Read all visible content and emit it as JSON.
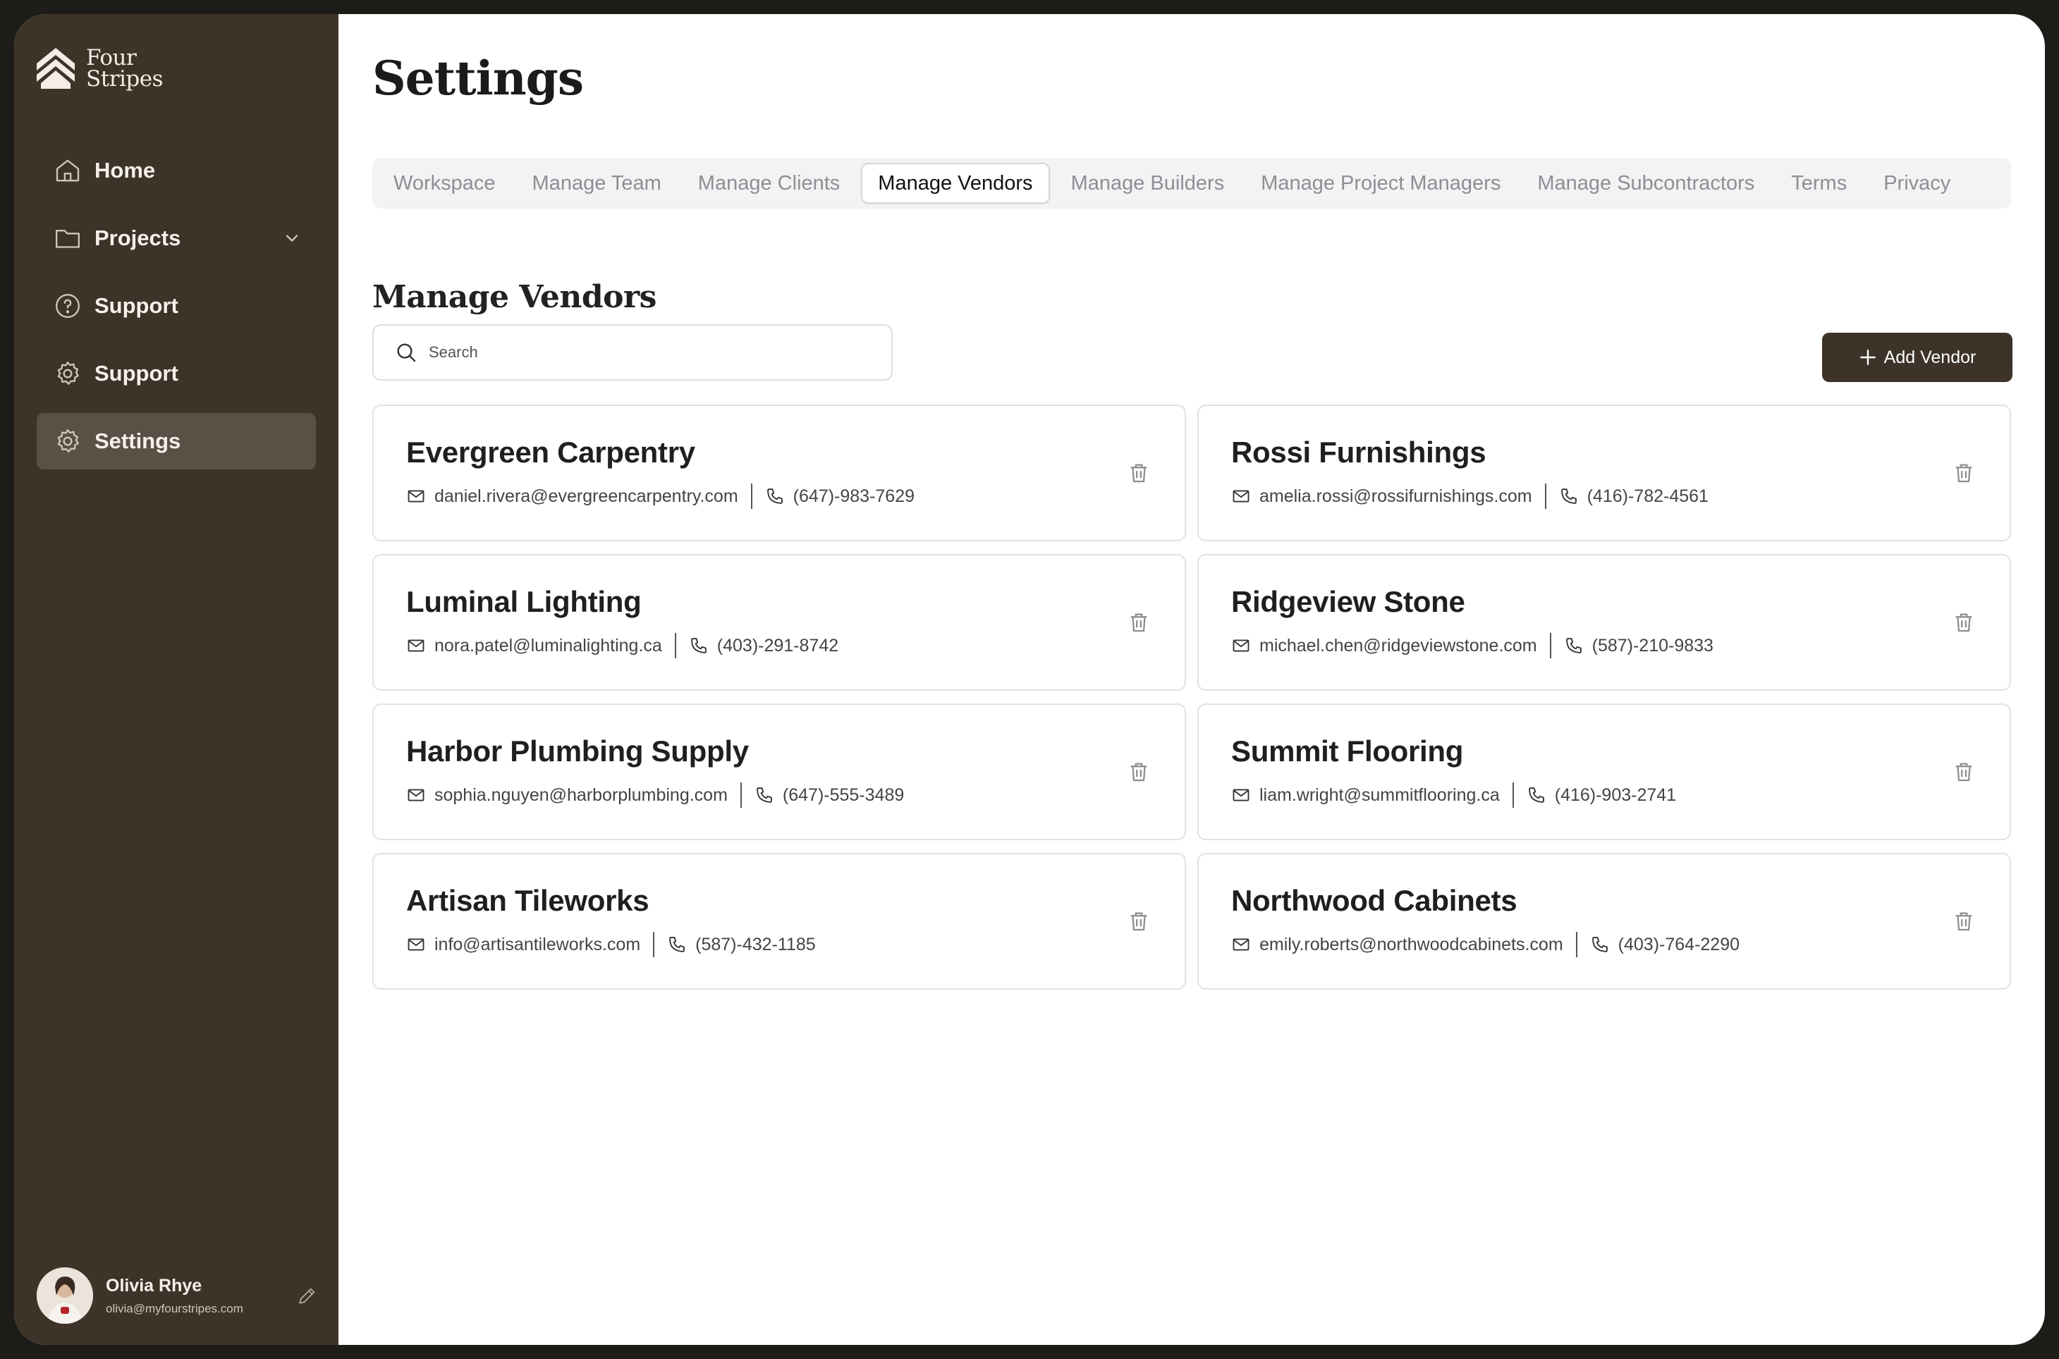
{
  "brand": {
    "line1": "Four",
    "line2": "Stripes"
  },
  "sidebar": {
    "items": [
      {
        "label": "Home",
        "icon": "home-icon"
      },
      {
        "label": "Projects",
        "icon": "folder-icon"
      },
      {
        "label": "Support",
        "icon": "help-circle-icon"
      },
      {
        "label": "Support",
        "icon": "gear-icon"
      },
      {
        "label": "Settings",
        "icon": "gear-icon"
      }
    ],
    "active_index": 4
  },
  "user": {
    "name": "Olivia Rhye",
    "email": "olivia@myfourstripes.com"
  },
  "page": {
    "title": "Settings"
  },
  "tabs": [
    "Workspace",
    "Manage Team",
    "Manage Clients",
    "Manage Vendors",
    "Manage Builders",
    "Manage Project Managers",
    "Manage Subcontractors",
    "Terms",
    "Privacy"
  ],
  "active_tab": "Manage Vendors",
  "section": {
    "title": "Manage Vendors"
  },
  "search": {
    "placeholder": "Search"
  },
  "add_button": {
    "label": "Add Vendor"
  },
  "vendors": [
    {
      "name": "Evergreen Carpentry",
      "email": "daniel.rivera@evergreencarpentry.com",
      "phone": "(647)-983-7629"
    },
    {
      "name": "Rossi Furnishings",
      "email": "amelia.rossi@rossifurnishings.com",
      "phone": "(416)-782-4561"
    },
    {
      "name": "Luminal Lighting",
      "email": "nora.patel@luminalighting.ca",
      "phone": "(403)-291-8742"
    },
    {
      "name": "Ridgeview Stone",
      "email": "michael.chen@ridgeviewstone.com",
      "phone": "(587)-210-9833"
    },
    {
      "name": "Harbor Plumbing Supply",
      "email": "sophia.nguyen@harborplumbing.com",
      "phone": "(647)-555-3489"
    },
    {
      "name": "Summit Flooring",
      "email": "liam.wright@summitflooring.ca",
      "phone": "(416)-903-2741"
    },
    {
      "name": "Artisan Tileworks",
      "email": "info@artisantileworks.com",
      "phone": "(587)-432-1185"
    },
    {
      "name": "Northwood Cabinets",
      "email": "emily.roberts@northwoodcabinets.com",
      "phone": "(403)-764-2290"
    }
  ],
  "colors": {
    "sidebar_bg": "#3d3328",
    "sidebar_active": "#5b5045",
    "primary_button": "#3d3328"
  }
}
